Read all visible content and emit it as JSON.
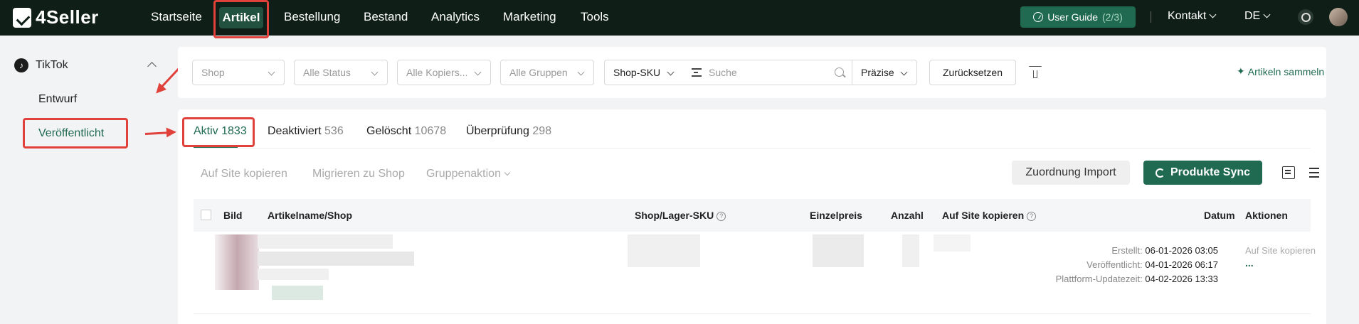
{
  "brand": {
    "name": "4Seller"
  },
  "nav": {
    "items": [
      {
        "label": "Startseite"
      },
      {
        "label": "Artikel"
      },
      {
        "label": "Bestellung"
      },
      {
        "label": "Bestand"
      },
      {
        "label": "Analytics"
      },
      {
        "label": "Marketing"
      },
      {
        "label": "Tools"
      }
    ],
    "active": "Artikel",
    "user_guide": {
      "label": "User Guide",
      "count": "(2/3)"
    },
    "contact": "Kontakt",
    "language": "DE"
  },
  "sidebar": {
    "platform": "TikTok",
    "items": [
      {
        "label": "Entwurf"
      },
      {
        "label": "Veröffentlicht"
      }
    ],
    "active": "Veröffentlicht"
  },
  "filters": {
    "shop": "Shop",
    "status": "Alle Status",
    "copy": "Alle Kopiers...",
    "groups": "Alle Gruppen",
    "sku_type": "Shop-SKU",
    "search_placeholder": "Suche",
    "match": "Präzise",
    "reset": "Zurücksetzen",
    "collect": "Artikeln sammeln"
  },
  "tabs": [
    {
      "label": "Aktiv",
      "count": "1833"
    },
    {
      "label": "Deaktiviert",
      "count": "536"
    },
    {
      "label": "Gelöscht",
      "count": "10678"
    },
    {
      "label": "Überprüfung",
      "count": "298"
    }
  ],
  "actions": {
    "copy_site": "Auf Site kopieren",
    "migrate": "Migrieren zu Shop",
    "group_action": "Gruppenaktion",
    "import_mapping": "Zuordnung Import",
    "sync": "Produkte Sync"
  },
  "table": {
    "headers": {
      "image": "Bild",
      "name": "Artikelname/Shop",
      "sku": "Shop/Lager-SKU",
      "price": "Einzelpreis",
      "qty": "Anzahl",
      "copy_site": "Auf Site kopieren",
      "date": "Datum",
      "actions": "Aktionen"
    },
    "rows": [
      {
        "created_label": "Erstellt:",
        "created": "06-01-2026 03:05",
        "published_label": "Veröffentlicht:",
        "published": "04-01-2026 06:17",
        "updated_label": "Plattform-Updatezeit:",
        "updated": "04-02-2026 13:33",
        "action": "Auf Site kopieren",
        "more": "..."
      }
    ]
  },
  "colors": {
    "brand_green": "#1f6a50",
    "topbar": "#0f1f18",
    "highlight_red": "#e0413a"
  }
}
